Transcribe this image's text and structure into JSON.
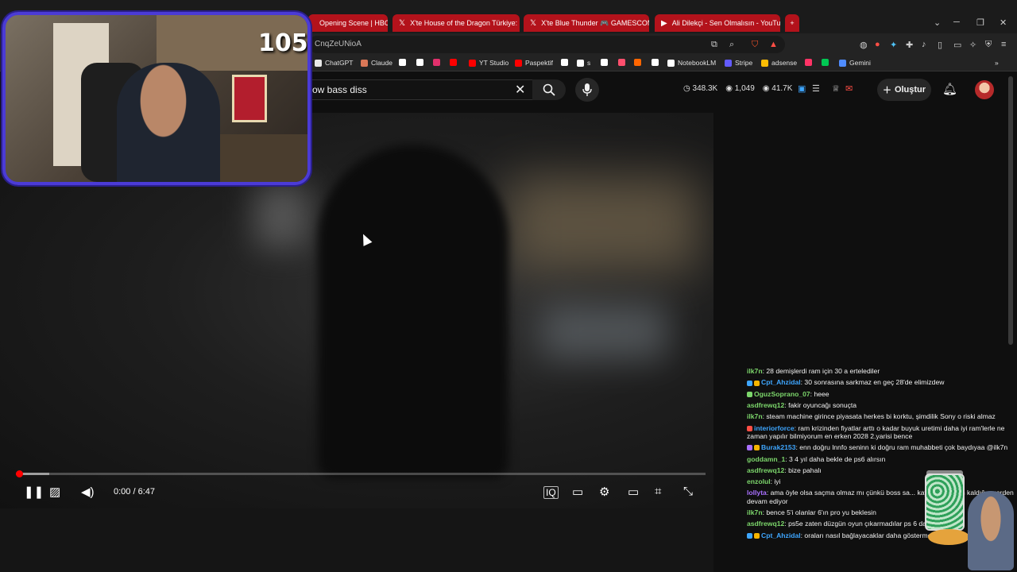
{
  "tabs": [
    {
      "label": "Opening Scene | HBO Max",
      "icon": "hbo-icon",
      "style": "red"
    },
    {
      "label": "X'te House of the Dragon Türkiye: \"G",
      "icon": "x-icon",
      "style": "red"
    },
    {
      "label": "X'te Blue Thunder 🎮 GAMESCOM: \"",
      "icon": "x-icon",
      "style": "red"
    },
    {
      "label": "Ali Dilekçi - Sen Olmalısın - YouTube",
      "icon": "youtube-icon",
      "style": "red"
    }
  ],
  "new_tab_label": "+",
  "address": {
    "url": "CnqZeUNioA"
  },
  "bookmarks": [
    {
      "label": "ChatGPT",
      "color": "#e8e8e8"
    },
    {
      "label": "Claude",
      "color": "#d97757"
    },
    {
      "label": "",
      "color": "#ffffff"
    },
    {
      "label": "",
      "color": "#ffffff"
    },
    {
      "label": "",
      "color": "#e1306c"
    },
    {
      "label": "",
      "color": "#ff0000"
    },
    {
      "label": "YT Studio",
      "color": "#ff0000"
    },
    {
      "label": "Paspektif",
      "color": "#ff0000"
    },
    {
      "label": "",
      "color": "#ffffff"
    },
    {
      "label": "s",
      "color": "#ffffff"
    },
    {
      "label": "",
      "color": "#ffffff"
    },
    {
      "label": "",
      "color": "#ff4f6d"
    },
    {
      "label": "",
      "color": "#ff6600"
    },
    {
      "label": "",
      "color": "#ffffff"
    },
    {
      "label": "NotebookLM",
      "color": "#ffffff"
    },
    {
      "label": "Stripe",
      "color": "#635bff"
    },
    {
      "label": "adsense",
      "color": "#fbbc04"
    },
    {
      "label": "",
      "color": "#ff3366"
    },
    {
      "label": "",
      "color": "#00c853"
    },
    {
      "label": "Gemini",
      "color": "#4f8cff"
    }
  ],
  "search": {
    "query": "ow bass diss"
  },
  "stats": {
    "subs": "348.3K",
    "likes": "1,049",
    "views": "41.7K"
  },
  "header": {
    "create_label": "Oluştur"
  },
  "player": {
    "time": "0:00 / 6:47",
    "progress": 0.005,
    "buffered": 0.048
  },
  "webcam": {
    "counter": "105"
  },
  "chat": [
    {
      "user": "ilk7n",
      "color": "#7cd66b",
      "text": ": 28 demişlerdi ram için 30 a ertelediler"
    },
    {
      "user": "Cpt_Ahzidal",
      "color": "#3ea6ff",
      "text": ": 30 sonrasına sarkmaz en geç 28'de elimizdew",
      "badges": [
        "#3ea6ff",
        "#f5b400"
      ]
    },
    {
      "user": "OguzSoprano_07",
      "color": "#7cd66b",
      "text": ": heee",
      "badges": [
        "#7cd66b"
      ]
    },
    {
      "user": "asdfrewq12",
      "color": "#7cd66b",
      "text": ": fakir oyuncağı sonuçta"
    },
    {
      "user": "ilk7n",
      "color": "#7cd66b",
      "text": ": steam machine girince piyasata herkes bi korktu, şimdilik Sony o riski almaz"
    },
    {
      "user": "interiorforce",
      "color": "#3ea6ff",
      "text": ": ram krizinden fiyatlar arttı o kadar buyuk uretimi daha iyi ram'lerle ne zaman yapılır bilmiyorum en erken 2028 2.yarisi bence",
      "badges": [
        "#ff4e45"
      ],
      "wrap": true
    },
    {
      "user": "Burak2153",
      "color": "#3ea6ff",
      "text": ": enn doğru lnnfo seninn ki doğru ram muhabbeti çok baydıyaa @ilk7n",
      "badges": [
        "#a970ff",
        "#f5b400"
      ]
    },
    {
      "user": "goddamn_1",
      "color": "#7cd66b",
      "text": ": 3 4 yıl daha bekle de ps6 alırsın"
    },
    {
      "user": "asdfrewq12",
      "color": "#7cd66b",
      "text": ": bize pahalı"
    },
    {
      "user": "enzolul",
      "color": "#7cd66b",
      "text": ": iyi"
    },
    {
      "user": "lollyta",
      "color": "#a970ff",
      "text": ": ama öyle olsa saçma olmaz mı çünkü boss sa... kaybetmiyorsun kaldığın yerden devam ediyor",
      "wrap": true
    },
    {
      "user": "ilk7n",
      "color": "#7cd66b",
      "text": ": bence 5'i olanlar 6'ın pro yu beklesin"
    },
    {
      "user": "asdfrewq12",
      "color": "#7cd66b",
      "text": ": ps5e zaten düzgün oyun çıkarmadılar ps 6 daha iyi olu"
    },
    {
      "user": "Cpt_Ahzidal",
      "color": "#3ea6ff",
      "text": ": oraları nasıl bağlayacaklar daha göstermediler ç",
      "badges": [
        "#3ea6ff",
        "#f5b400"
      ]
    }
  ]
}
